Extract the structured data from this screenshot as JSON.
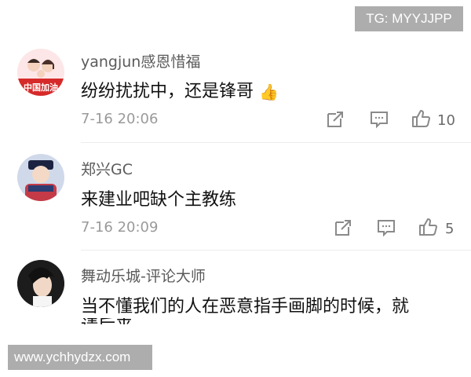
{
  "watermarks": {
    "top": "TG: MYYJJPP",
    "bottom": "www.ychhydzx.com"
  },
  "comments": [
    {
      "username": "yangjun感恩惜福",
      "text": "纷纷扰扰中，还是锋哥",
      "emoji": "👍",
      "time": "7-16 20:06",
      "likes": "10",
      "avatar_caption": "中国加油"
    },
    {
      "username": "郑兴GC",
      "text": "来建业吧缺个主教练",
      "time": "7-16 20:09",
      "likes": "5"
    },
    {
      "username": "舞动乐城-评论大师",
      "text": "当不懂我们的人在恶意指手画脚的时候，就",
      "text_cut": "请后来"
    }
  ]
}
